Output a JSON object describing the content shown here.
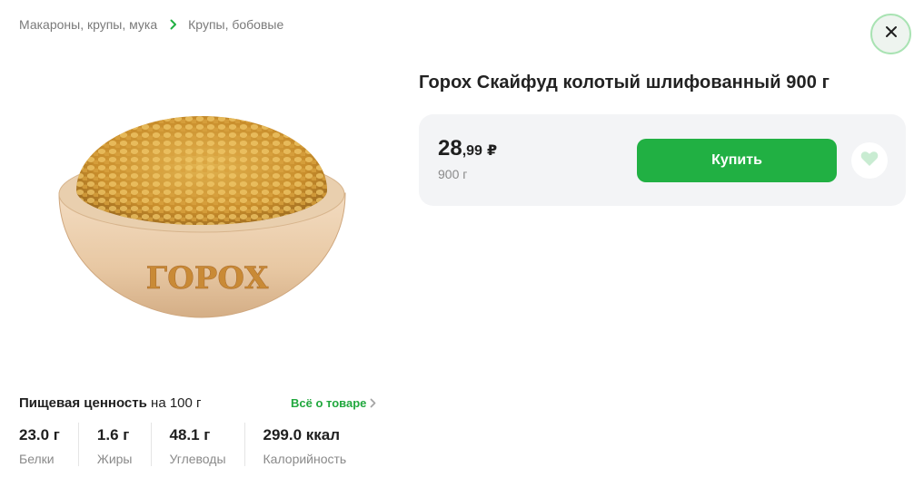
{
  "breadcrumb": {
    "items": [
      "Макароны, крупы, мука",
      "Крупы, бобовые"
    ]
  },
  "product": {
    "title": "Горох Скайфуд колотый шлифованный 900 г",
    "image_label": "ГОРОХ",
    "price_int": "28",
    "price_frac": ",99",
    "currency": "₽",
    "weight": "900 г",
    "buy_label": "Купить"
  },
  "nutrition": {
    "title": "Пищевая ценность",
    "per": "на 100 г",
    "all_link": "Всё о товаре",
    "items": [
      {
        "value": "23.0 г",
        "label": "Белки"
      },
      {
        "value": "1.6 г",
        "label": "Жиры"
      },
      {
        "value": "48.1 г",
        "label": "Углеводы"
      },
      {
        "value": "299.0 ккал",
        "label": "Калорийность"
      }
    ]
  },
  "colors": {
    "accent": "#21b043",
    "card_bg": "#f3f4f6",
    "close_border": "#a9e3b3"
  },
  "icons": {
    "close": "close-icon",
    "favorite": "heart-icon",
    "chevron": "chevron-right-icon"
  }
}
